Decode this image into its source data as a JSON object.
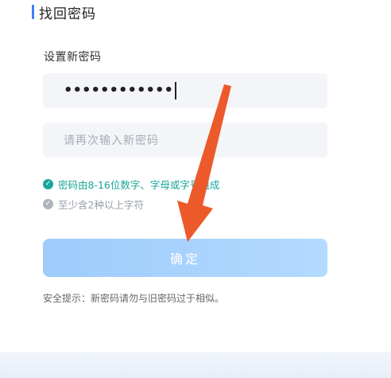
{
  "header": {
    "title": "找回密码"
  },
  "form": {
    "new_password_label": "设置新密码",
    "password_value": "••••••••••••",
    "confirm_placeholder": "请再次输入新密码"
  },
  "rules": [
    {
      "text": "密码由8-16位数字、字母或字号组成",
      "status": "passed"
    },
    {
      "text": "至少含2种以上字符",
      "status": "pending"
    }
  ],
  "confirm_button": {
    "label": "确定"
  },
  "tip": "安全提示：新密码请勿与旧密码过于相似。",
  "colors": {
    "accent": "#3b82f6",
    "success": "#1aa69b",
    "pending": "#aeb3bc",
    "button": "#a8d2fd",
    "annotation_arrow": "#ec5a2b"
  }
}
